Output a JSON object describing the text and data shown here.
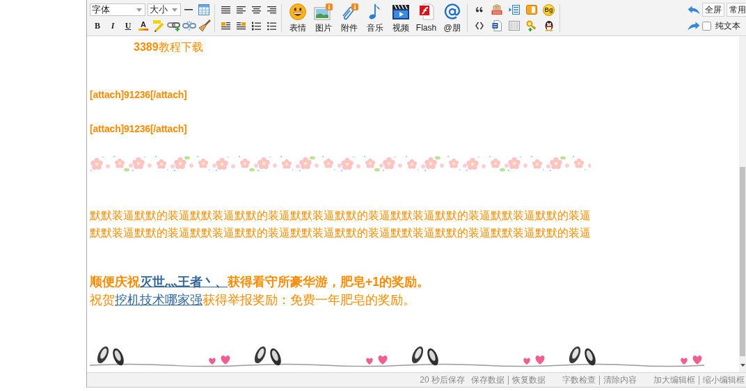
{
  "toolbar": {
    "font_select": {
      "value": "字体"
    },
    "size_select": {
      "value": "大小"
    },
    "format_buttons": [
      {
        "kind": "bold",
        "glyph": "B"
      },
      {
        "kind": "italic",
        "glyph": "I"
      },
      {
        "kind": "underline",
        "glyph": "U"
      },
      {
        "kind": "color",
        "glyph": "A"
      }
    ],
    "media_buttons": [
      "表情",
      "图片",
      "附件",
      "音乐",
      "视频",
      "Flash",
      "@朋"
    ],
    "background_button": "Bg",
    "fullscreen_button": "全屏",
    "common_button": "常用",
    "plain_text": {
      "label": "纯文本",
      "checked": false
    }
  },
  "post": {
    "title": "**3389**教程下载",
    "attachments": [
      "[attach]91236[/attach]",
      "[attach]91236[/attach]"
    ],
    "filler_lines": [
      "默默装逼默默的装逼默默装逼默默的装逼默默装逼默默的装逼默默装逼默默的装逼默默装逼默默的装逼",
      "默默装逼默默的装逼默默装逼默默的装逼默默装逼默默的装逼默默装逼默默的装逼默默装逼默默的装逼"
    ],
    "congrats": [
      {
        "bold": true,
        "before": "顺便庆祝",
        "link": "灭世灬王者丶、",
        "after": "获得看守所豪华游，肥皂+1的奖励。"
      },
      {
        "bold": false,
        "before": "祝贺",
        "link": "挖机技术哪家强",
        "after": "获得举报奖励：免费一年肥皂的奖励。"
      }
    ]
  },
  "status_bar": {
    "autosave": "20 秒后保存",
    "link_groups": [
      [
        "保存数据",
        "恢复数据"
      ],
      [
        "字数检查",
        "清除内容"
      ],
      [
        "加大编辑框",
        "缩小编辑框"
      ]
    ]
  }
}
